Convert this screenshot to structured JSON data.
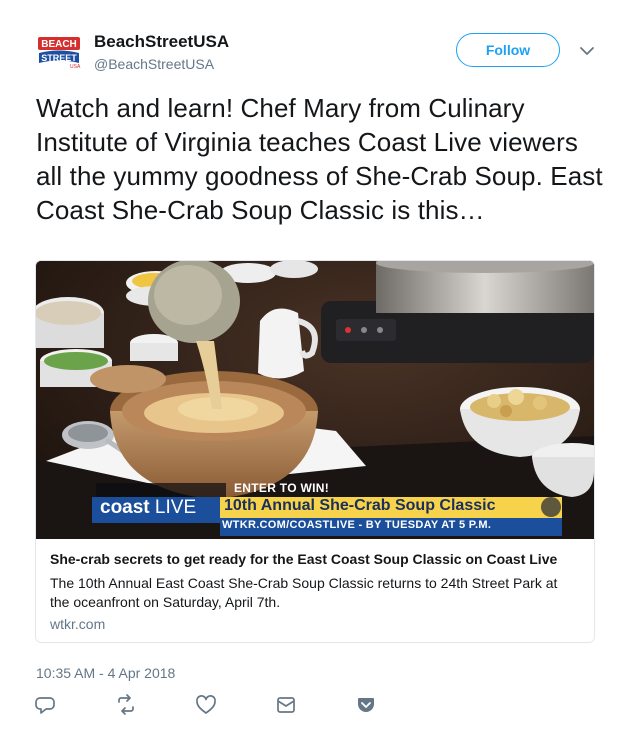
{
  "user": {
    "display_name": "BeachStreetUSA",
    "handle": "@BeachStreetUSA",
    "avatar_icon": "beachstreet-logo"
  },
  "follow_label": "Follow",
  "tweet_text": "Watch and learn! Chef Mary from Culinary Institute of Virginia teaches Coast Live viewers all the yummy goodness of She-Crab Soup. East Coast She-Crab Soup Classic is this…",
  "card": {
    "title": "She-crab secrets to get ready for the East Coast Soup Classic on Coast Live",
    "description": "The 10th Annual East Coast She-Crab Soup Classic returns to  24th Street Park at the oceanfront on Saturday, April 7th.",
    "domain": "wtkr.com",
    "media": {
      "enter_text": "ENTER TO WIN!",
      "logo_text_a": "coast",
      "logo_text_b": "LIVE",
      "banner_title": "10th Annual She-Crab Soup Classic",
      "banner_sub": "WTKR.COM/COASTLIVE - BY TUESDAY AT 5 P.M."
    }
  },
  "timestamp": "10:35 AM - 4 Apr 2018",
  "actions": [
    "reply-icon",
    "retweet-icon",
    "like-icon",
    "dm-icon",
    "bookmark-icon"
  ],
  "colors": {
    "accent": "#1da1f2",
    "muted": "#657786",
    "text": "#14171a"
  }
}
